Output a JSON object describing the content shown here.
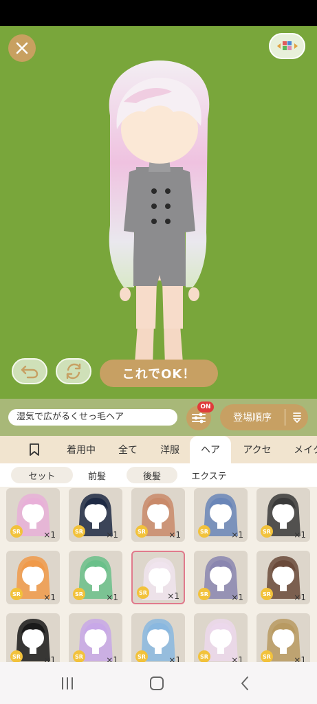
{
  "toolbar": {
    "ok_label": "これでOK！"
  },
  "search": {
    "value": "湿気で広がるくせっ毛ヘア"
  },
  "filter": {
    "badge": "ON"
  },
  "sort": {
    "label": "登場順序"
  },
  "tabs": [
    {
      "label": ""
    },
    {
      "label": "着用中"
    },
    {
      "label": "全て"
    },
    {
      "label": "洋服"
    },
    {
      "label": "ヘア"
    },
    {
      "label": "アクセ"
    },
    {
      "label": "メイク"
    }
  ],
  "subtabs": [
    {
      "label": "セット"
    },
    {
      "label": "前髪"
    },
    {
      "label": "後髪"
    },
    {
      "label": "エクステ"
    }
  ],
  "items": [
    {
      "rarity": "SR",
      "qty": "×1",
      "hair_color": "#e8b0d8"
    },
    {
      "rarity": "SR",
      "qty": "×1",
      "hair_color": "#1e2a44"
    },
    {
      "rarity": "SR",
      "qty": "×1",
      "hair_color": "#c98a6a"
    },
    {
      "rarity": "SR",
      "qty": "×1",
      "hair_color": "#6a86b8"
    },
    {
      "rarity": "SR",
      "qty": "×1",
      "hair_color": "#3a3a3a"
    },
    {
      "rarity": "SR",
      "qty": "×1",
      "hair_color": "#f09a4a"
    },
    {
      "rarity": "SR",
      "qty": "×1",
      "hair_color": "#6ac08a"
    },
    {
      "rarity": "SR",
      "qty": "×1",
      "hair_color": "#f0e4ee"
    },
    {
      "rarity": "SR",
      "qty": "×1",
      "hair_color": "#8a86b0"
    },
    {
      "rarity": "SR",
      "qty": "×1",
      "hair_color": "#6a4a3a"
    },
    {
      "rarity": "SR",
      "qty": "×1",
      "hair_color": "#1a1a1a"
    },
    {
      "rarity": "SR",
      "qty": "×1",
      "hair_color": "#c8a8e8"
    },
    {
      "rarity": "SR",
      "qty": "×1",
      "hair_color": "#8ab8e0"
    },
    {
      "rarity": "SR",
      "qty": "×1",
      "hair_color": "#ecd8ec"
    },
    {
      "rarity": "SR",
      "qty": "×1",
      "hair_color": "#b89a62"
    }
  ],
  "selected_item": 7,
  "colors": {
    "stage": "#79a63b",
    "accent": "#c7a063",
    "badge": "#e03b3b",
    "sr": "#f2c23b"
  }
}
